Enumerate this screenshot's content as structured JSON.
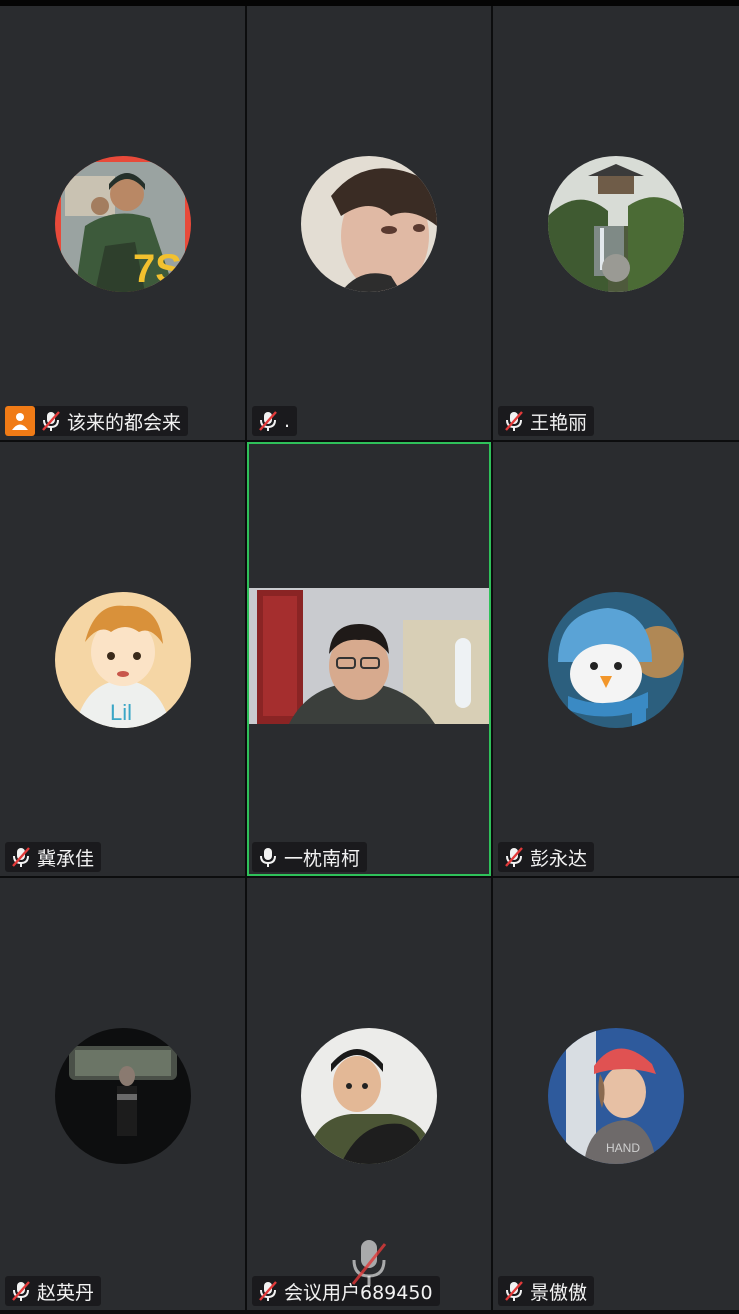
{
  "participants": [
    {
      "name": "该来的都会来",
      "muted": true,
      "host": true,
      "avatar": "soldier-photo"
    },
    {
      "name": ".",
      "muted": true,
      "avatar": "young-man-selfie"
    },
    {
      "name": "王艳丽",
      "muted": true,
      "avatar": "garden-pavilion"
    },
    {
      "name": "冀承佳",
      "muted": true,
      "avatar": "anime-boy"
    },
    {
      "name": "一枕南柯",
      "muted": false,
      "active_speaker": true,
      "avatar": "live-camera-video"
    },
    {
      "name": "彭永达",
      "muted": true,
      "avatar": "knitted-penguin"
    },
    {
      "name": "赵英丹",
      "muted": true,
      "avatar": "dark-car-photo"
    },
    {
      "name": "会议用户689450",
      "muted": true,
      "avatar": "kid-photo"
    },
    {
      "name": "景傲傲",
      "muted": true,
      "avatar": "child-red-cap"
    }
  ],
  "colors": {
    "tile_bg": "#2a2c2f",
    "active_border": "#2fc15a",
    "host_badge": "#f07b16",
    "mute_red": "#e23a3a"
  },
  "icons": {
    "muted": "mic-off-icon",
    "unmuted": "mic-icon",
    "host": "host-person-icon",
    "overlay": "mic-off-icon"
  }
}
